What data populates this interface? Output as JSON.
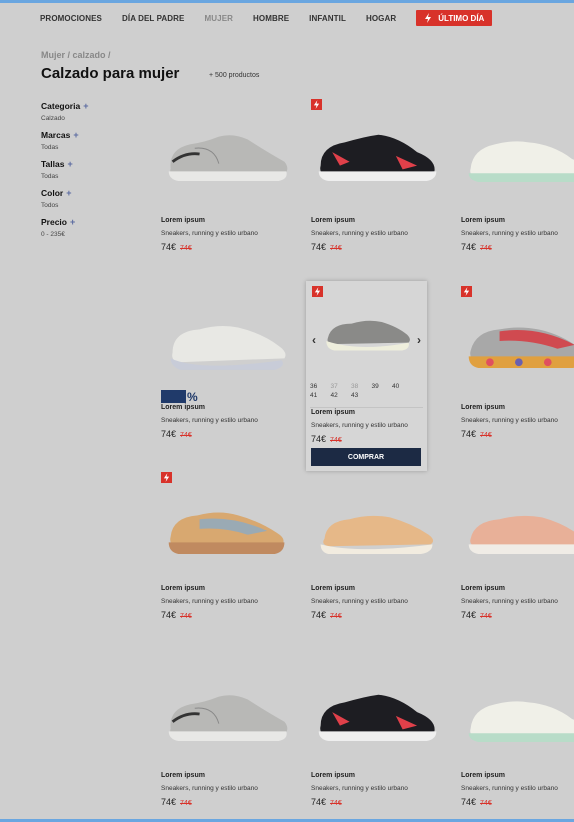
{
  "nav": {
    "items": [
      "PROMOCIONES",
      "DÍA DEL PADRE",
      "MUJER",
      "HOMBRE",
      "INFANTIL",
      "HOGAR"
    ],
    "active": "MUJER",
    "promo_label": "ÚLTIMO DÍA",
    "accent_color": "#d8322a"
  },
  "breadcrumb": "Mujer / calzado /",
  "page_title": "Calzado para mujer",
  "product_count": "+ 500 productos",
  "filters": [
    {
      "label": "Categoria",
      "value": "Calzado"
    },
    {
      "label": "Marcas",
      "value": "Todas"
    },
    {
      "label": "Tallas",
      "value": "Todas"
    },
    {
      "label": "Color",
      "value": "Todos"
    },
    {
      "label": "Precio",
      "value": "0 - 235€"
    }
  ],
  "product": {
    "name": "Lorem ipsum",
    "description": "Sneakers, running y estilo urbano",
    "price": "74€",
    "old_price": "74€"
  },
  "hover_card": {
    "sizes": [
      "36",
      "37",
      "38",
      "39",
      "40",
      "41",
      "42",
      "43"
    ],
    "unavailable_sizes": [
      "37",
      "38"
    ],
    "buy_label": "COMPRAR"
  },
  "discount_badge": {
    "suffix": "%"
  }
}
